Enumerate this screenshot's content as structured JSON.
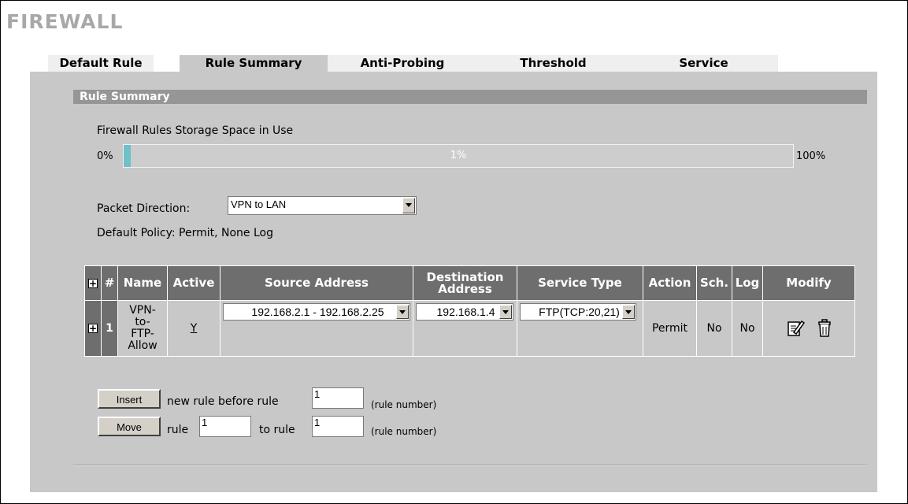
{
  "page": {
    "title": "FIREWALL"
  },
  "tabs": [
    {
      "label": "Default Rule"
    },
    {
      "label": "Rule Summary"
    },
    {
      "label": "Anti-Probing"
    },
    {
      "label": "Threshold"
    },
    {
      "label": "Service"
    }
  ],
  "section": {
    "title": "Rule Summary"
  },
  "storage": {
    "label": "Firewall Rules Storage Space in Use",
    "min_label": "0%",
    "max_label": "100%",
    "value_label": "1%",
    "value_percent": 1
  },
  "direction": {
    "label": "Packet Direction:",
    "value": "VPN to LAN"
  },
  "policy": {
    "text": "Default Policy: Permit, None Log"
  },
  "table": {
    "headers": {
      "expand": "+",
      "num": "#",
      "name": "Name",
      "active": "Active",
      "source": "Source Address",
      "dest": "Destination Address",
      "service": "Service Type",
      "action": "Action",
      "sch": "Sch.",
      "log": "Log",
      "modify": "Modify"
    },
    "rows": [
      {
        "expand": "+",
        "num": "1",
        "name": "VPN-to-FTP-Allow",
        "active": "Y",
        "source": "192.168.2.1 - 192.168.2.25",
        "dest": "192.168.1.4",
        "service": "FTP(TCP:20,21)",
        "action": "Permit",
        "sch": "No",
        "log": "No"
      }
    ]
  },
  "controls": {
    "insert_label": "Insert",
    "insert_text": "new rule before rule",
    "insert_value": "1",
    "rule_number_hint": "(rule number)",
    "move_label": "Move",
    "move_rule_text": "rule",
    "move_from_value": "1",
    "move_to_text": "to rule",
    "move_to_value": "1"
  },
  "icons": {
    "edit": "edit-icon",
    "delete": "trash-icon"
  }
}
